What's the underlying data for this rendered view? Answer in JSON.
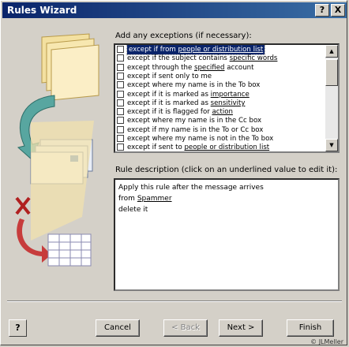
{
  "window": {
    "title": "Rules Wizard",
    "help_btn": "?",
    "close_btn": "X"
  },
  "exceptions": {
    "label": "Add any exceptions (if necessary):",
    "items": [
      {
        "parts": [
          "except if from ",
          "people or distribution list"
        ],
        "selected": true
      },
      {
        "parts": [
          "except if the subject contains ",
          "specific words"
        ]
      },
      {
        "parts": [
          "except through the ",
          "specified",
          " account"
        ]
      },
      {
        "parts": [
          "except if sent only to me"
        ]
      },
      {
        "parts": [
          "except where my name is in the To box"
        ]
      },
      {
        "parts": [
          "except if it is marked as ",
          "importance"
        ]
      },
      {
        "parts": [
          "except if it is marked as ",
          "sensitivity"
        ]
      },
      {
        "parts": [
          "except if it is flagged for ",
          "action"
        ]
      },
      {
        "parts": [
          "except where my name is in the Cc box"
        ]
      },
      {
        "parts": [
          "except if my name is in the To or Cc box"
        ]
      },
      {
        "parts": [
          "except where my name is not in the To box"
        ]
      },
      {
        "parts": [
          "except if sent to ",
          "people or distribution list"
        ]
      }
    ]
  },
  "description": {
    "label": "Rule description (click on an underlined value to edit it):",
    "line1": "Apply this rule after the message arrives",
    "line2_prefix": "from ",
    "line2_link": "Spammer",
    "line3": "delete it"
  },
  "buttons": {
    "help": "?",
    "cancel": "Cancel",
    "back": "< Back",
    "next": "Next >",
    "finish": "Finish"
  },
  "credit": "© JLMeller"
}
